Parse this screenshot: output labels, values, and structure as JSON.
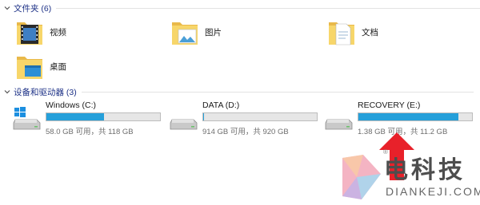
{
  "groups": {
    "folders": {
      "title": "文件夹 (6)"
    },
    "drives": {
      "title": "设备和驱动器 (3)"
    }
  },
  "folders": [
    {
      "name": "视频",
      "icon": "video-folder-icon"
    },
    {
      "name": "图片",
      "icon": "pictures-folder-icon"
    },
    {
      "name": "文档",
      "icon": "documents-folder-icon"
    },
    {
      "name": "桌面",
      "icon": "desktop-folder-icon"
    }
  ],
  "drives": [
    {
      "name": "Windows (C:)",
      "free": "58.0 GB 可用，共 118 GB",
      "used_fraction": 0.51,
      "icon": "windows-drive-icon"
    },
    {
      "name": "DATA (D:)",
      "free": "914 GB 可用，共 920 GB",
      "used_fraction": 0.01,
      "icon": "hard-drive-icon"
    },
    {
      "name": "RECOVERY (E:)",
      "free": "1.38 GB 可用，共 11.2 GB",
      "used_fraction": 0.88,
      "icon": "hard-drive-icon"
    }
  ],
  "colors": {
    "accent": "#26a0da",
    "header_text": "#1e3287",
    "arrow": "#e8212a"
  },
  "watermark": {
    "name": "电科技",
    "latin": "DIANKEJI.COM",
    "reg": "®"
  }
}
